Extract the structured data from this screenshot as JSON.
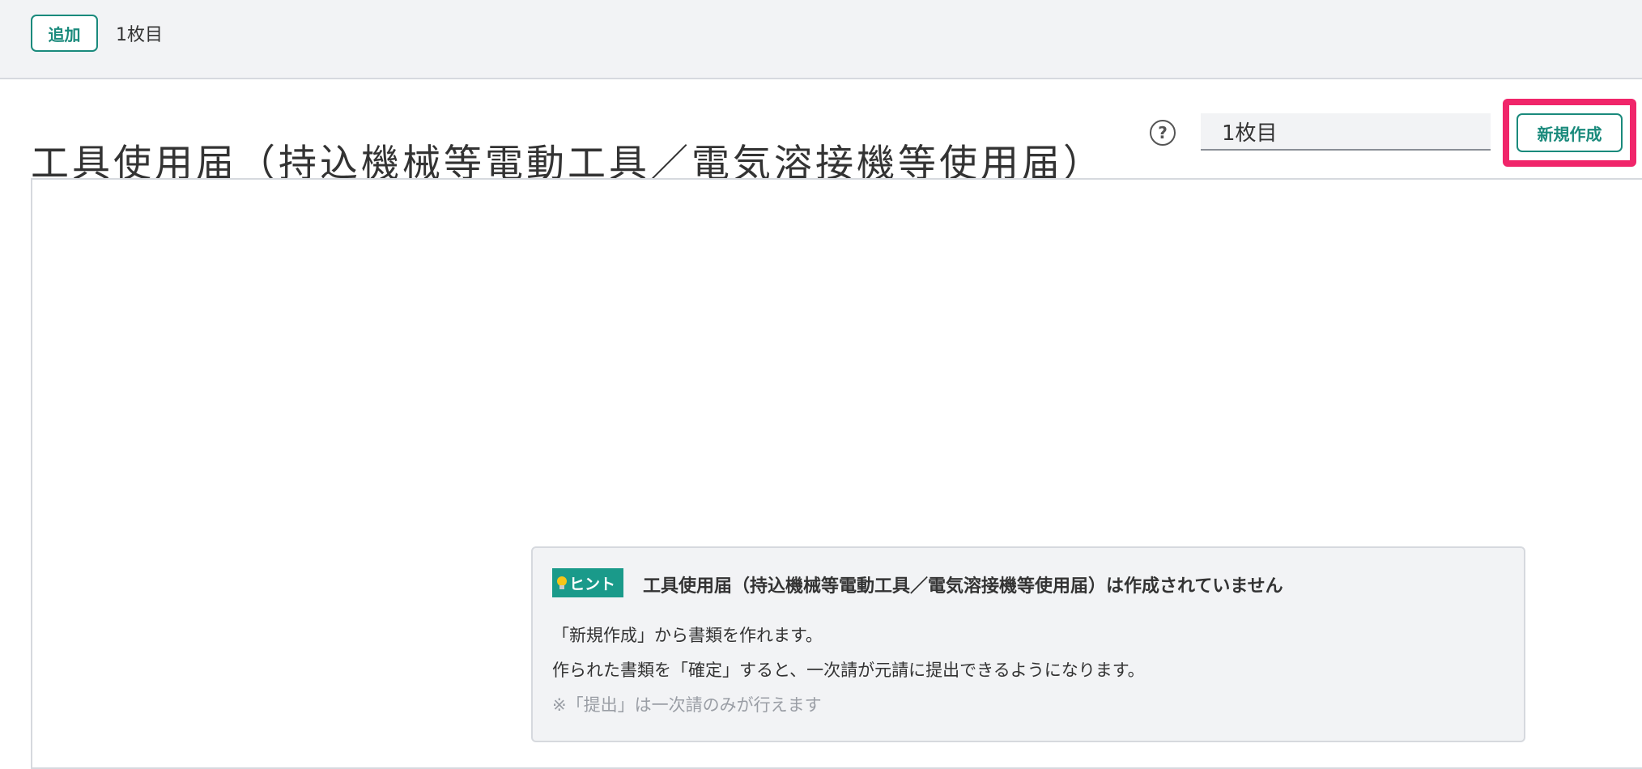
{
  "topbar": {
    "add_label": "追加",
    "sheet_label": "1枚目"
  },
  "header": {
    "title": "工具使用届（持込機械等電動工具／電気溶接機等使用届）",
    "help_glyph": "?",
    "sheet_select_value": "1枚目",
    "new_button_label": "新規作成"
  },
  "hint": {
    "badge_label": "ヒント",
    "title": "工具使用届（持込機械等電動工具／電気溶接機等使用届）は作成されていません",
    "line1": "「新規作成」から書類を作れます。",
    "line2": "作られた書類を「確定」すると、一次請が元請に提出できるようになります。",
    "note": "※「提出」は一次請のみが行えます"
  },
  "colors": {
    "accent": "#1a8a7c",
    "highlight": "#f0256a",
    "topbar_bg": "#f2f3f5"
  },
  "icons": {
    "help": "question-circle-icon",
    "hint": "lightbulb-icon"
  }
}
